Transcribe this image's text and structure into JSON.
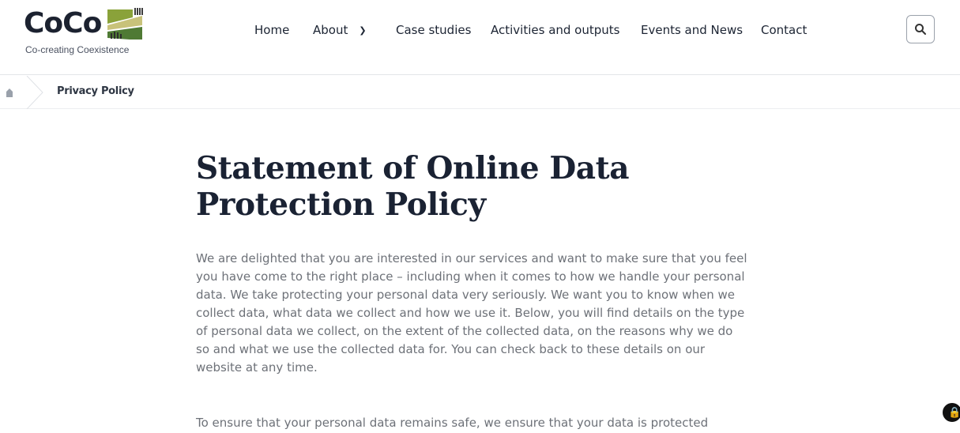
{
  "header": {
    "logo_text": "CoCo",
    "logo_tagline": "Co-creating Coexistence",
    "nav": [
      {
        "label": "Home"
      },
      {
        "label": "About"
      },
      {
        "label": "Case studies"
      },
      {
        "label": "Activities and outputs"
      },
      {
        "label": "Events and News"
      },
      {
        "label": "Contact"
      }
    ],
    "search_icon": "search-icon"
  },
  "breadcrumb": {
    "home_icon": "home-icon",
    "current": "Privacy Policy"
  },
  "main": {
    "title": "Statement of Online Data Protection Policy",
    "paragraphs": [
      "We are delighted that you are interested in our services and want to make sure that you feel you have come to the right place – including when it comes to how we handle your personal data. We take protecting your personal data very seriously. We want you to know when we collect data, what data we collect and how we use it. Below, you will find details on the type of personal data we collect, on the extent of the collected data, on the reasons why we do so and what we use the collected data for. You can check back to these details on our website at any time.",
      "To ensure that your personal data remains safe, we ensure that your data is protected"
    ]
  },
  "colors": {
    "logo_green": "#6a8a2c",
    "logo_dark_green": "#3f5e2a",
    "text_dark": "#1a2233",
    "text_muted": "#6d7178"
  }
}
